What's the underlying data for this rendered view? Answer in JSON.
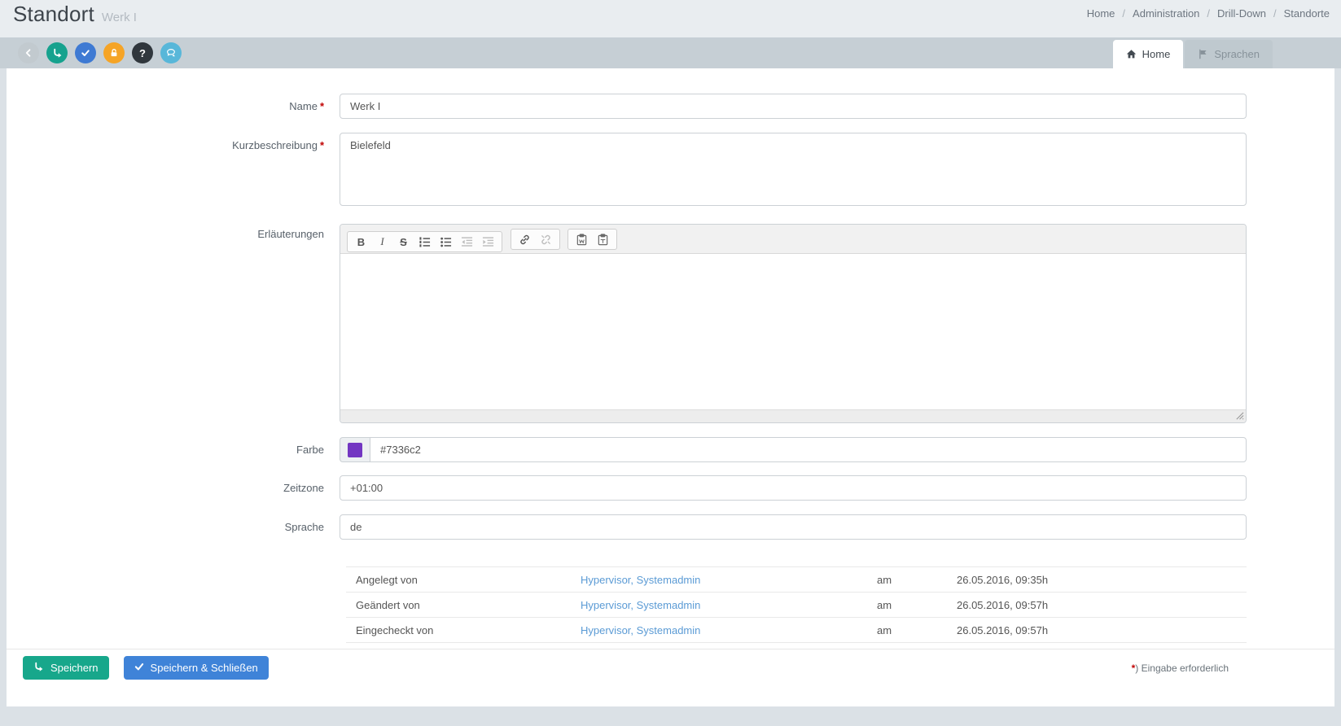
{
  "header": {
    "title": "Standort",
    "subtitle": "Werk I",
    "breadcrumb": {
      "items": [
        "Home",
        "Administration",
        "Drill-Down",
        "Standorte"
      ],
      "separator": "/"
    }
  },
  "toolbar": {
    "buttons": [
      {
        "name": "back",
        "color": "#c2cacf"
      },
      {
        "name": "save",
        "color": "#16a28e"
      },
      {
        "name": "approve",
        "color": "#3e7ad3"
      },
      {
        "name": "unlock",
        "color": "#f5a426"
      },
      {
        "name": "help",
        "color": "#30373d",
        "glyph": "?"
      },
      {
        "name": "comments",
        "color": "#58b7d9"
      }
    ]
  },
  "tabs": {
    "home": {
      "label": "Home",
      "active": true
    },
    "sprachen": {
      "label": "Sprachen",
      "active": false
    }
  },
  "form": {
    "required_marker": "*",
    "name": {
      "label": "Name",
      "value": "Werk I"
    },
    "kurzbeschreibung": {
      "label": "Kurzbeschreibung",
      "value": "Bielefeld"
    },
    "erlaeuterungen": {
      "label": "Erläuterungen",
      "value": "",
      "editor_buttons": [
        "bold",
        "italic",
        "strikethrough",
        "ordered-list",
        "unordered-list",
        "outdent",
        "indent",
        "link",
        "unlink",
        "paste-from-word",
        "paste-text"
      ],
      "labels": {
        "bold": "B",
        "italic": "I",
        "strike": "S"
      }
    },
    "farbe": {
      "label": "Farbe",
      "value": "#7336c2",
      "swatch": "#7336c2"
    },
    "zeitzone": {
      "label": "Zeitzone",
      "value": "+01:00"
    },
    "sprache": {
      "label": "Sprache",
      "value": "de"
    }
  },
  "audit": {
    "rows": [
      {
        "label": "Angelegt von",
        "user": "Hypervisor, Systemadmin",
        "preposition": "am",
        "datetime": "26.05.2016, 09:35h"
      },
      {
        "label": "Geändert von",
        "user": "Hypervisor, Systemadmin",
        "preposition": "am",
        "datetime": "26.05.2016, 09:57h"
      },
      {
        "label": "Eingecheckt von",
        "user": "Hypervisor, Systemadmin",
        "preposition": "am",
        "datetime": "26.05.2016, 09:57h"
      }
    ]
  },
  "footer": {
    "save": "Speichern",
    "save_close": "Speichern & Schließen",
    "note_marker": "*",
    "note_text": ") Eingabe erforderlich"
  },
  "colors": {
    "page_background": "#dbe1e6",
    "toolbar_strip": "#c6cfd5",
    "accent_save": "#17a78b",
    "accent_primary": "#3f83d8",
    "link": "#5b9bd5",
    "required": "#c00000",
    "swatch": "#7336c2"
  }
}
